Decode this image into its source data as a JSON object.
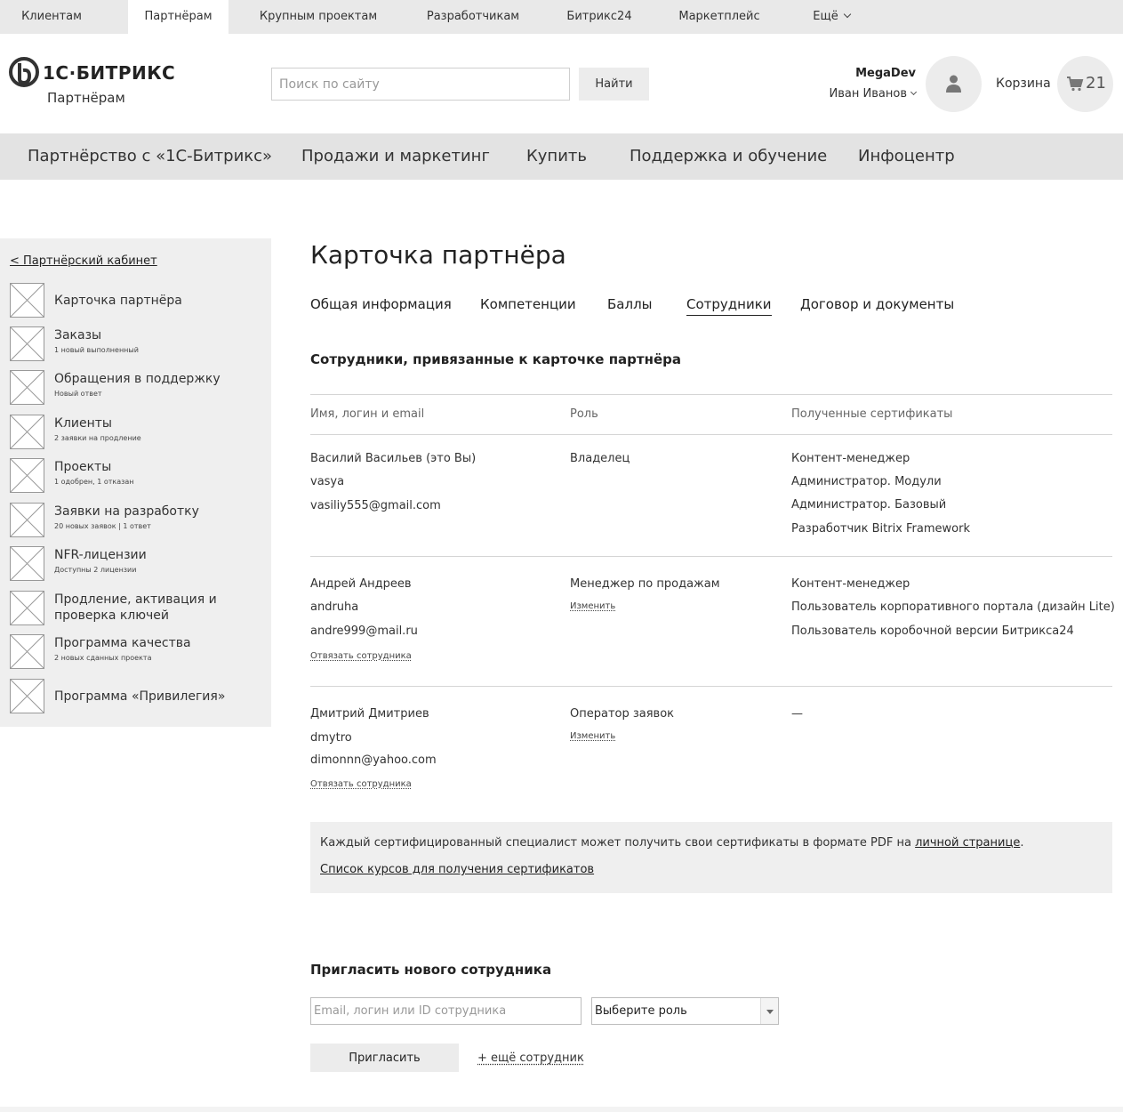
{
  "top_tabs": [
    {
      "label": "Клиентам"
    },
    {
      "label": "Партнёрам",
      "active": true
    },
    {
      "label": "Крупным проектам"
    },
    {
      "label": "Разработчикам"
    },
    {
      "label": "Битрикс24"
    },
    {
      "label": "Маркетплейс"
    },
    {
      "label": "Ещё"
    }
  ],
  "header": {
    "logo_text": "1С·БИТРИКС",
    "logo_sub": "Партнёрам",
    "search_placeholder": "Поиск по сайту",
    "search_button": "Найти",
    "company": "MegaDev",
    "user_name": "Иван Иванов",
    "cart_label": "Корзина",
    "cart_count": "21"
  },
  "main_nav": [
    "Партнёрство с «1С-Битрикс»",
    "Продажи и маркетинг",
    "Купить",
    "Поддержка и обучение",
    "Инфоцентр"
  ],
  "sidebar": {
    "back_link": "< Партнёрский кабинет",
    "items": [
      {
        "label": "Карточка партнёра",
        "sub": ""
      },
      {
        "label": "Заказы",
        "sub": "1 новый выполненный"
      },
      {
        "label": "Обращения в поддержку",
        "sub": "Новый ответ"
      },
      {
        "label": "Клиенты",
        "sub": "2 заявки на продление"
      },
      {
        "label": "Проекты",
        "sub": "1 одобрен, 1 отказан"
      },
      {
        "label": "Заявки на разработку",
        "sub": "20 новых заявок | 1 ответ"
      },
      {
        "label": "NFR-лицензии",
        "sub": "Доступны 2 лицензии"
      },
      {
        "label": "Продление, активация и проверка ключей",
        "label_line1": "Продление, активация и",
        "label_line2": "проверка ключей",
        "sub": ""
      },
      {
        "label": "Программа качества",
        "sub": "2 новых сданных проекта"
      },
      {
        "label": "Программа «Привилегия»",
        "sub": ""
      }
    ]
  },
  "main": {
    "title": "Карточка партнёра",
    "tabs": [
      {
        "label": "Общая информация"
      },
      {
        "label": "Компетенции"
      },
      {
        "label": "Баллы"
      },
      {
        "label": "Сотрудники",
        "active": true
      },
      {
        "label": "Договор и документы"
      }
    ],
    "section_title": "Сотрудники, привязанные к карточке партнёра",
    "table": {
      "headers": [
        "Имя, логин и email",
        "Роль",
        "Полученные сертификаты"
      ],
      "rows": [
        {
          "name": "Василий Васильев (это Вы)",
          "login": "vasya",
          "email": "vasiliy555@gmail.com",
          "role": "Владелец",
          "certs": [
            "Контент-менеджер",
            "Администратор. Модули",
            "Администратор. Базовый",
            "Разработчик Bitrix Framework"
          ]
        },
        {
          "name": "Андрей Андреев",
          "login": "andruha",
          "email": "andre999@mail.ru",
          "role": "Менеджер по продажам",
          "change_link": "Изменить",
          "unlink": "Отвязать сотрудника",
          "certs": [
            "Контент-менеджер",
            "Пользователь корпоративного портала (дизайн Lite)",
            "Пользователь коробочной версии Битрикса24"
          ]
        },
        {
          "name": "Дмитрий Дмитриев",
          "login": "dmytro",
          "email": "dimonnn@yahoo.com",
          "role": "Оператор заявок",
          "change_link": "Изменить",
          "unlink": "Отвязать сотрудника",
          "certs": [
            "—"
          ]
        }
      ]
    },
    "info": {
      "text_before": "Каждый сертифицированный специалист может получить свои сертификаты в формате PDF на ",
      "link": "личной странице",
      "text_after": ".",
      "courses_link": "Список курсов для получения сертификатов"
    },
    "invite": {
      "title": "Пригласить нового сотрудника",
      "input_placeholder": "Email, логин или ID сотрудника",
      "role_value": "Выберите роль",
      "button": "Пригласить",
      "more_link": "+ ещё сотрудник"
    }
  }
}
